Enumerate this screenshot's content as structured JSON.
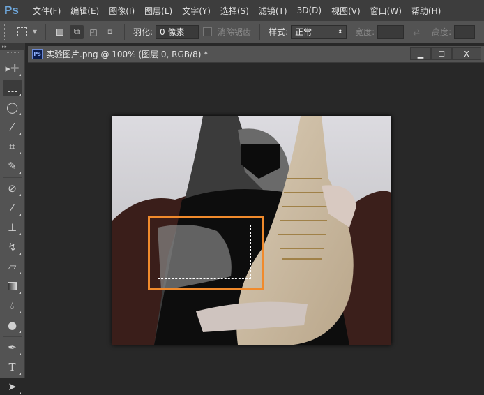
{
  "app": {
    "logo": "Ps"
  },
  "menu": [
    "文件(F)",
    "编辑(E)",
    "图像(I)",
    "图层(L)",
    "文字(Y)",
    "选择(S)",
    "滤镜(T)",
    "3D(D)",
    "视图(V)",
    "窗口(W)",
    "帮助(H)"
  ],
  "options": {
    "feather_label": "羽化:",
    "feather_value": "0 像素",
    "antialias_label": "消除锯齿",
    "style_label": "样式:",
    "style_value": "正常",
    "width_label": "宽度:",
    "height_label": "高度:"
  },
  "document": {
    "title": "实验图片.png @ 100% (图层 0, RGB/8) *",
    "badge": "Ps",
    "close": "X"
  },
  "colors": {
    "highlight": "#f08a2c"
  }
}
